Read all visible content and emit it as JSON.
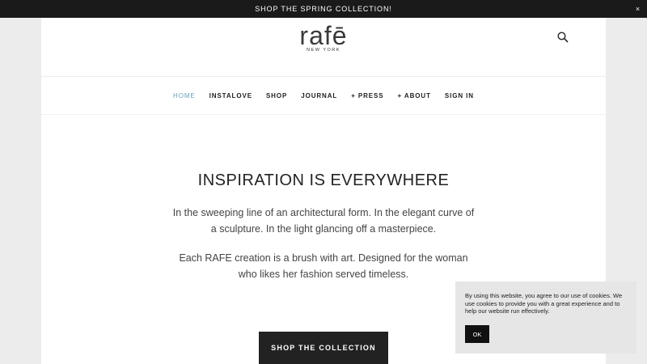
{
  "promo": {
    "text": "SHOP THE SPRING COLLECTION!",
    "close": "×"
  },
  "header": {
    "logo_text": "rafē",
    "logo_sub": "NEW YORK",
    "search_icon": "search-icon"
  },
  "nav": {
    "items": [
      {
        "label": "HOME"
      },
      {
        "label": "INSTALOVE"
      },
      {
        "label": "SHOP"
      },
      {
        "label": "JOURNAL"
      },
      {
        "label": "+ PRESS"
      },
      {
        "label": "+ ABOUT"
      },
      {
        "label": "SIGN IN"
      }
    ],
    "active_color": "#6a9fbd"
  },
  "hero": {
    "title": "INSPIRATION IS EVERYWHERE",
    "paragraph1": "In the sweeping line of an architectural form. In the elegant curve of a sculpture. In the light glancing off a masterpiece.",
    "paragraph2": "Each RAFE creation is a brush with art. Designed for the woman who likes her fashion served timeless.",
    "cta": "SHOP THE COLLECTION"
  },
  "cookie": {
    "text": "By using this website, you agree to our use of cookies. We use cookies to provide you with a great experience and to help our website run effectively.",
    "ok": "OK"
  }
}
